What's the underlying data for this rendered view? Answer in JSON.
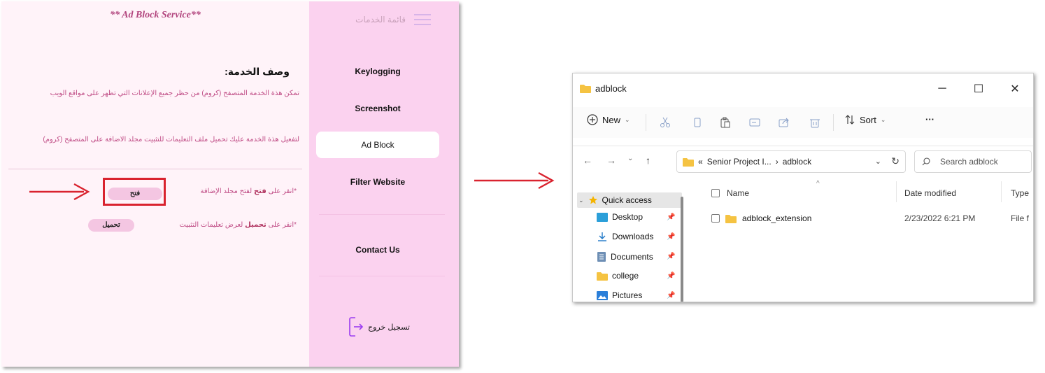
{
  "web_app": {
    "service_title": "** Ad Block Service**",
    "description_heading": "وصف الخدمة:",
    "description_line_1": "تمكن هذة الخدمة المتصفح (كروم) من حظر جميع الإعلانات التي تظهر على مواقع الويب",
    "description_line_2": "لتفعيل هذة الخدمة عليك تحميل ملف التعليمات للتثبيت مجلد الاضافة على المتصفح (كروم)",
    "open_instruction_prefix": "*انقر على ",
    "open_instruction_keyword": "فتح",
    "open_instruction_suffix": " لفتح مجلد الإضافة",
    "open_button_label": "فتح",
    "download_instruction_prefix": "*انقر على ",
    "download_instruction_keyword": "تحميل",
    "download_instruction_suffix": " لعرض تعليمات التثبيت",
    "download_button_label": "تحميل",
    "sidebar": {
      "menu_label": "قائمة الخدمات",
      "items": [
        {
          "label": "Keylogging"
        },
        {
          "label": "Screenshot"
        },
        {
          "label": "Ad Block",
          "active": true
        },
        {
          "label": "Filter Website"
        },
        {
          "label": "Contact Us"
        }
      ],
      "logout_label": "تسجيل خروج"
    },
    "colors": {
      "content_bg": "#fff3f9",
      "sidebar_bg": "#fbd2ef",
      "accent_pink": "#c04d86",
      "highlight_red": "#d9232f"
    }
  },
  "explorer": {
    "title": "adblock",
    "toolbar": {
      "new_label": "New",
      "sort_label": "Sort",
      "more_label": "···"
    },
    "address": {
      "prefix": "«",
      "segment_1": "Senior Project I...",
      "separator": "›",
      "segment_2": "adblock"
    },
    "search_placeholder": "Search adblock",
    "nav_tree": [
      {
        "label": "Quick access",
        "icon": "star-icon"
      },
      {
        "label": "Desktop",
        "icon": "desktop-folder-icon"
      },
      {
        "label": "Downloads",
        "icon": "download-arrow-icon"
      },
      {
        "label": "Documents",
        "icon": "document-icon"
      },
      {
        "label": "college",
        "icon": "folder-icon"
      },
      {
        "label": "Pictures",
        "icon": "pictures-icon"
      }
    ],
    "columns": {
      "name": "Name",
      "date_modified": "Date modified",
      "type": "Type"
    },
    "files": [
      {
        "name": "adblock_extension",
        "date_modified": "2/23/2022 6:21 PM",
        "type": "File f"
      }
    ]
  }
}
